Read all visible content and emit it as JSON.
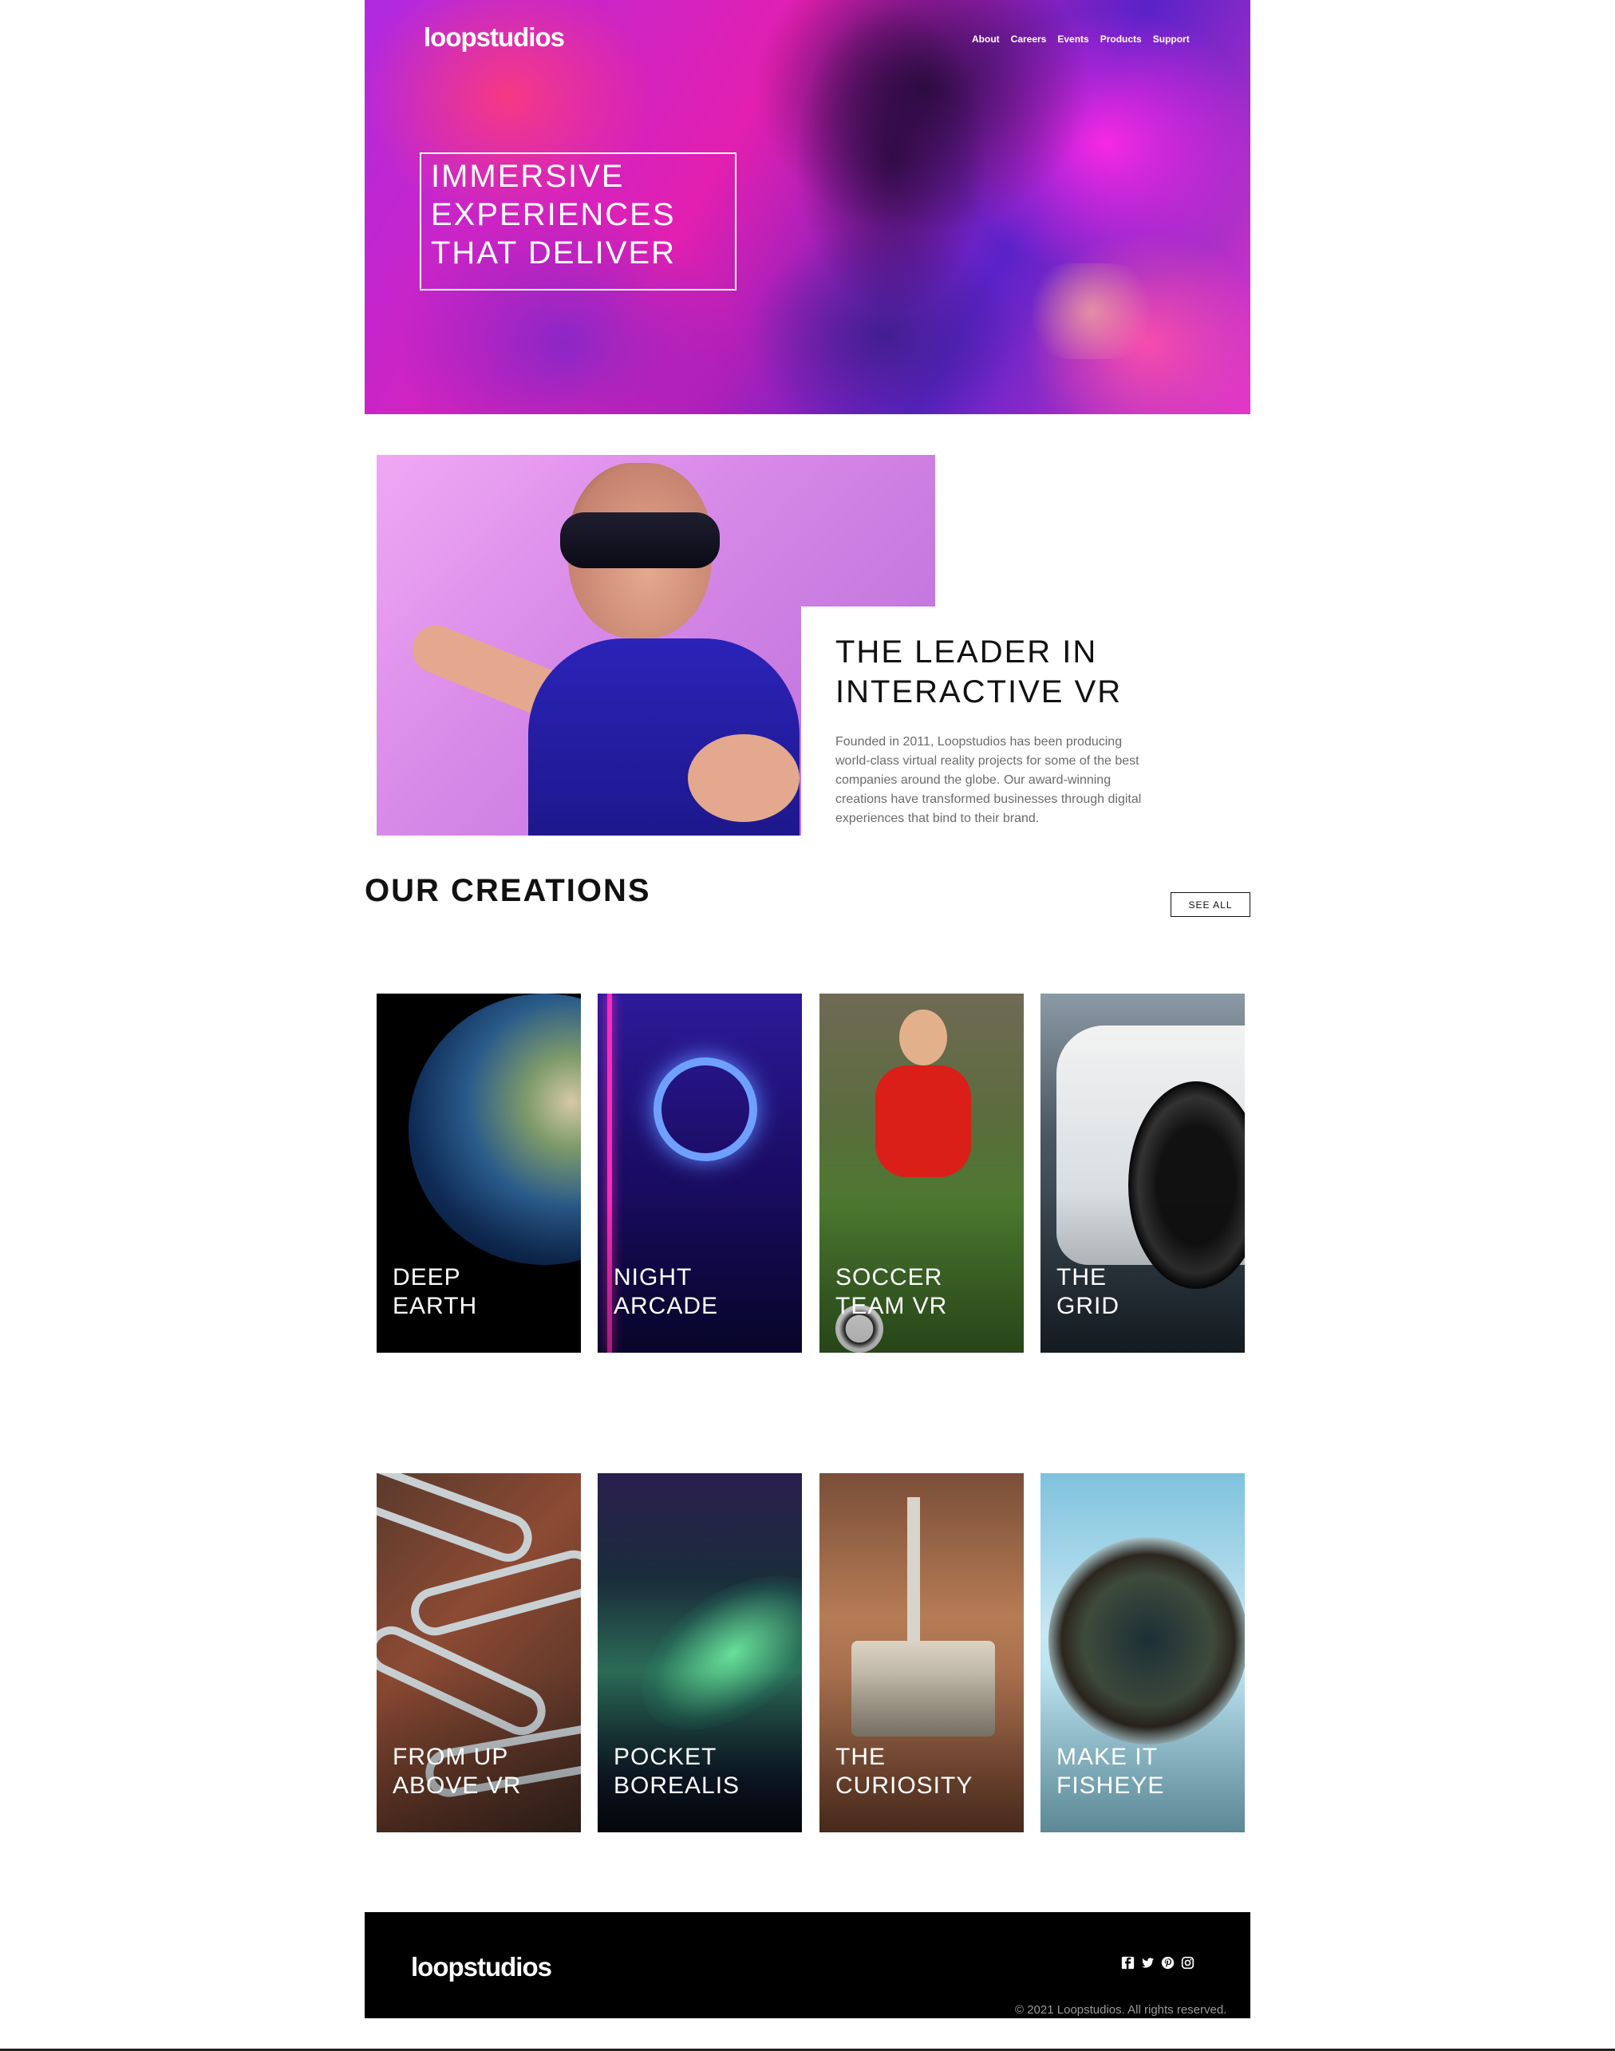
{
  "header": {
    "logo": "loopstudios",
    "nav": [
      "About",
      "Careers",
      "Events",
      "Products",
      "Support"
    ]
  },
  "hero": {
    "lines": [
      "IMMERSIVE",
      "EXPERIENCES",
      "THAT DELIVER"
    ]
  },
  "intro": {
    "title_lines": [
      "THE LEADER IN",
      "INTERACTIVE VR"
    ],
    "text": "Founded in 2011, Loopstudios has been producing world-class virtual reality projects for some of the best companies around the globe. Our award-winning creations have transformed businesses through digital experiences that bind to their brand."
  },
  "creations": {
    "title": "OUR CREATIONS",
    "see_all": "SEE ALL",
    "items": [
      {
        "l1": "DEEP",
        "l2": "EARTH"
      },
      {
        "l1": "NIGHT",
        "l2": "ARCADE"
      },
      {
        "l1": "SOCCER",
        "l2": "TEAM VR"
      },
      {
        "l1": "THE",
        "l2": "GRID"
      },
      {
        "l1": "FROM UP",
        "l2": "ABOVE VR"
      },
      {
        "l1": "POCKET",
        "l2": "BOREALIS"
      },
      {
        "l1": "THE",
        "l2": "CURIOSITY"
      },
      {
        "l1": "MAKE IT",
        "l2": "FISHEYE"
      }
    ]
  },
  "footer": {
    "logo": "loopstudios",
    "socials": [
      "facebook-icon",
      "twitter-icon",
      "pinterest-icon",
      "instagram-icon"
    ],
    "copyright": "© 2021 Loopstudios. All rights reserved."
  }
}
